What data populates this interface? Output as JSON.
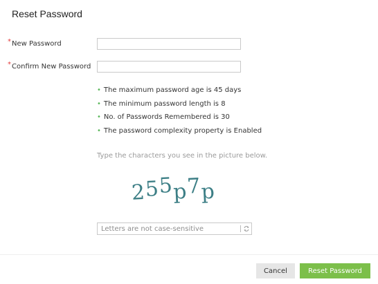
{
  "dialog": {
    "title": "Reset Password"
  },
  "form": {
    "required_marker": "*",
    "new_password_label": "New Password",
    "new_password_value": "",
    "confirm_password_label": "Confirm New Password",
    "confirm_password_value": ""
  },
  "rules": [
    "The maximum password age is 45 days",
    "The minimum password length is 8",
    "No. of Passwords Remembered is 30",
    "The password complexity property is Enabled"
  ],
  "captcha": {
    "instruction": "Type the characters you see in the picture below.",
    "image_text": "255p7p",
    "input_placeholder": "Letters are not case-sensitive",
    "input_value": "",
    "refresh_icon": "refresh-icon"
  },
  "footer": {
    "cancel_label": "Cancel",
    "reset_label": "Reset Password"
  },
  "colors": {
    "required": "#e33b3b",
    "bullet": "#5cb85c",
    "primary_button": "#7cbf4a",
    "captcha_text": "#3d7f86"
  }
}
